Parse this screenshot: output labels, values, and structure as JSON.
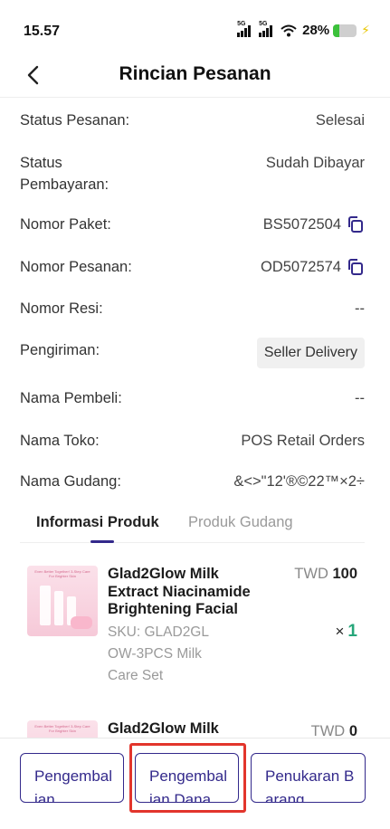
{
  "status_bar": {
    "time": "15.57",
    "network1": "5G",
    "network2": "5G",
    "battery_pct": "28%",
    "battery_level": 0.28,
    "icons": [
      "signal-icon",
      "signal-icon",
      "wifi-icon",
      "battery-icon",
      "charging-icon"
    ]
  },
  "header": {
    "title": "Rincian Pesanan",
    "back_icon": "chevron-left-icon"
  },
  "info": {
    "status_label": "Status Pesanan:",
    "status_value": "Selesai",
    "payment_label": "Status Pembayaran:",
    "payment_value": "Sudah Dibayar",
    "package_label": "Nomor Paket:",
    "package_value": "BS5072504",
    "order_label": "Nomor Pesanan:",
    "order_value": "OD5072574",
    "resi_label": "Nomor Resi:",
    "resi_value": "--",
    "shipping_label": "Pengiriman:",
    "shipping_value": "Seller Delivery",
    "buyer_label": "Nama Pembeli:",
    "buyer_value": "--",
    "store_label": "Nama Toko:",
    "store_value": "POS Retail Orders",
    "warehouse_label": "Nama Gudang:",
    "warehouse_value": "&<>\"12'®©22™×2÷"
  },
  "tabs": {
    "active": "Informasi Produk",
    "inactive": "Produk Gudang"
  },
  "products": [
    {
      "name": "Glad2Glow Milk Extract Niacinamide Brightening Facial",
      "sku": "SKU: GLAD2GL OW-3PCS Milk Care Set",
      "currency": "TWD",
      "price": "100",
      "qty_symbol": "×",
      "qty": "1",
      "thumb_text": "Even Better Together! 3-Step Care For Brighter Skin"
    },
    {
      "name": "Glad2Glow Milk",
      "currency": "TWD",
      "price": "0",
      "thumb_text": "Even Better Together! 3-Step Care For Brighter Skin"
    }
  ],
  "buttons": {
    "btn1": "Pengembalian",
    "btn2": "Pengembalian Dana",
    "btn3": "Penukaran Barang"
  },
  "colors": {
    "accent": "#33298b",
    "qty_green": "#26a67a",
    "highlight": "#e2352c"
  }
}
